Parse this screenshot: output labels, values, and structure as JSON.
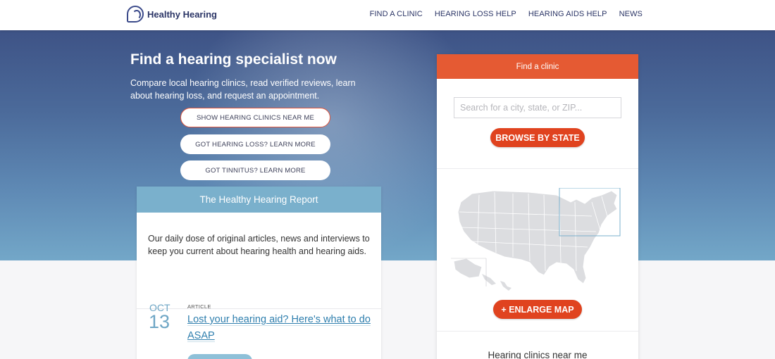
{
  "header": {
    "logo_text": "Healthy Hearing",
    "nav": [
      "FIND A CLINIC",
      "HEARING LOSS HELP",
      "HEARING AIDS HELP",
      "NEWS"
    ]
  },
  "hero": {
    "title": "Find a hearing specialist now",
    "subtitle": "Compare local hearing clinics, read verified reviews, learn about hearing loss, and request an appointment.",
    "buttons": [
      "SHOW HEARING CLINICS NEAR ME",
      "GOT HEARING LOSS? LEARN MORE",
      "GOT TINNITUS? LEARN MORE"
    ]
  },
  "report": {
    "title": "The Healthy Hearing Report",
    "description": "Our daily dose of original articles, news and interviews to keep you current about hearing health and hearing aids.",
    "article": {
      "month": "OCT",
      "day": "13",
      "tag": "ARTICLE",
      "title": "Lost your hearing aid? Here's what to do ASAP"
    }
  },
  "clinic": {
    "title": "Find a clinic",
    "search_placeholder": "Search for a city, state, or ZIP...",
    "browse_label": "BROWSE BY STATE",
    "enlarge_label": "+ ENLARGE MAP",
    "near_me_heading": "Hearing clinics near me"
  },
  "colors": {
    "accent_orange": "#e0431f",
    "report_blue": "#7ab0cc",
    "brand_navy": "#2b3566"
  },
  "icons": [
    "logo-ear-icon",
    "us-map-icon"
  ]
}
